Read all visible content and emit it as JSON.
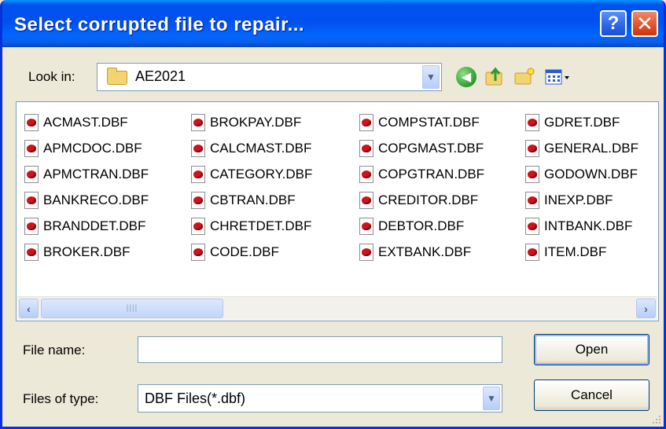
{
  "window": {
    "title": "Select corrupted file to repair...",
    "help_label": "?",
    "close_label": "✕"
  },
  "lookin": {
    "label": "Look in:",
    "value": "AE2021"
  },
  "files": {
    "columns": [
      [
        "ACMAST.DBF",
        "APMCDOC.DBF",
        "APMCTRAN.DBF",
        "BANKRECO.DBF",
        "BRANDDET.DBF",
        "BROKER.DBF"
      ],
      [
        "BROKPAY.DBF",
        "CALCMAST.DBF",
        "CATEGORY.DBF",
        "CBTRAN.DBF",
        "CHRETDET.DBF",
        "CODE.DBF"
      ],
      [
        "COMPSTAT.DBF",
        "COPGMAST.DBF",
        "COPGTRAN.DBF",
        "CREDITOR.DBF",
        "DEBTOR.DBF",
        "EXTBANK.DBF"
      ],
      [
        "GDRET.DBF",
        "GENERAL.DBF",
        "GODOWN.DBF",
        "INEXP.DBF",
        "INTBANK.DBF",
        "ITEM.DBF"
      ]
    ]
  },
  "filename": {
    "label": "File name:",
    "value": ""
  },
  "filetype": {
    "label": "Files of type:",
    "value": "DBF Files(*.dbf)"
  },
  "buttons": {
    "open": "Open",
    "cancel": "Cancel"
  }
}
